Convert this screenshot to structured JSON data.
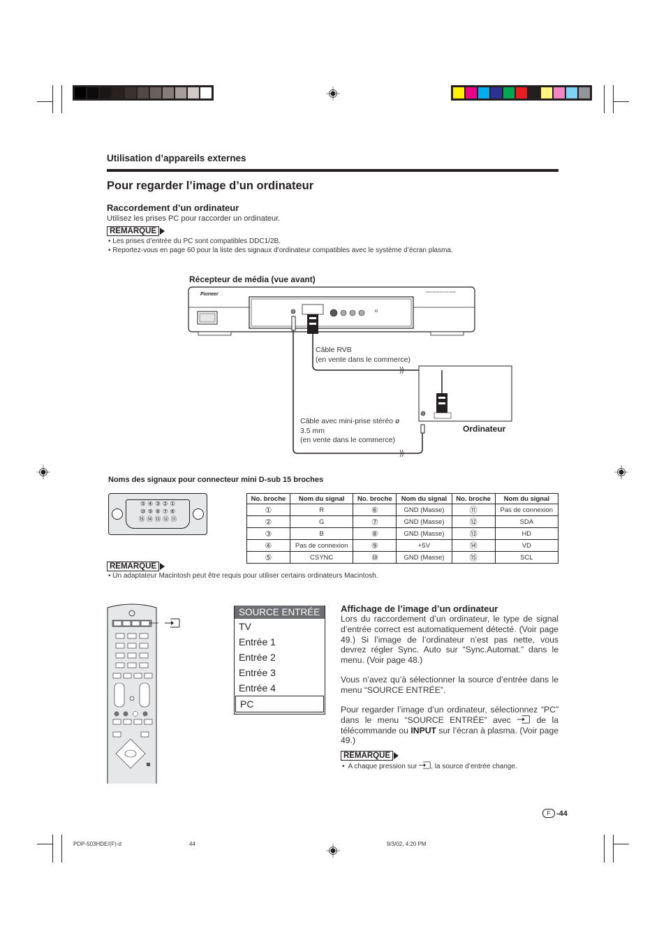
{
  "print_marks": {
    "grayscale_swatches": [
      "#000000",
      "#0d0b0b",
      "#1a1616",
      "#272220",
      "#3a3230",
      "#524845",
      "#6a605d",
      "#867c79",
      "#a69e9b",
      "#d1cac8",
      "#ffffff"
    ],
    "color_swatches": [
      "#fff200",
      "#ec008c",
      "#00aeef",
      "#2e3192",
      "#00a651",
      "#ed1c24",
      "#231f20",
      "#fff57e",
      "#f385c4",
      "#7dd4f5",
      "#939598"
    ]
  },
  "header": {
    "section": "Utilisation d’appareils externes",
    "title": "Pour regarder l’image d’un ordinateur"
  },
  "connection": {
    "heading": "Raccordement d’un ordinateur",
    "intro": "Utilisez les prises PC pour raccorder un ordinateur.",
    "remarque_label": "REMARQUE",
    "notes": [
      "Les prises d’entrée du PC sont compatibles DDC1/2B.",
      "Reportez-vous en page 60 pour la liste des signaux d’ordinateur compatibles avec le système d’écran plasma."
    ]
  },
  "diagram": {
    "receiver_label": "Récepteur de média (vue avant)",
    "brand": "Pioneer",
    "model_text": "MEDIA RECEIVER PDP-R503E",
    "rgb_cable_label_1": "Câble RVB",
    "rgb_cable_label_2": "(en vente dans le commerce)",
    "audio_cable_label_1": "Câble avec mini-prise stéréo ø",
    "audio_cable_label_2": "3.5 mm",
    "audio_cable_label_3": "(en vente dans le commerce)",
    "computer_label": "Ordinateur"
  },
  "pinout": {
    "title": "Noms des signaux pour connecteur mini D-sub 15 broches",
    "connector_rows": [
      [
        "⑤",
        "④",
        "③",
        "②",
        "①"
      ],
      [
        "⑩",
        "⑨",
        "⑧",
        "⑦",
        "⑥"
      ],
      [
        "⑮",
        "⑭",
        "⑬",
        "⑫",
        "⑪"
      ]
    ],
    "headers": [
      "No. broche",
      "Nom du signal",
      "No. broche",
      "Nom du signal",
      "No. broche",
      "Nom du signal"
    ],
    "rows": [
      [
        "①",
        "R",
        "⑥",
        "GND (Masse)",
        "⑪",
        "Pas de connexion"
      ],
      [
        "②",
        "G",
        "⑦",
        "GND (Masse)",
        "⑫",
        "SDA"
      ],
      [
        "③",
        "B",
        "⑧",
        "GND (Masse)",
        "⑬",
        "HD"
      ],
      [
        "④",
        "Pas de connexion",
        "⑨",
        "+5V",
        "⑭",
        "VD"
      ],
      [
        "⑤",
        "CSYNC",
        "⑩",
        "GND (Masse)",
        "⑮",
        "SCL"
      ]
    ],
    "remarque_label": "REMARQUE",
    "note": "Un adaptateur Macintosh peut être requis pour utiliser certains ordinateurs Macintosh."
  },
  "source_menu": {
    "header": "SOURCE ENTRÉE",
    "items": [
      "TV",
      "Entrée 1",
      "Entrée 2",
      "Entrée 3",
      "Entrée 4",
      "PC"
    ],
    "selected": "PC"
  },
  "display": {
    "heading": "Affichage de l’image d’un ordinateur",
    "para1": "Lors du raccordement d’un ordinateur, le type de signal d’entrée correct est automatiquement détecté. (Voir page 49.) Si l’image de l’ordinateur n’est pas nette, vous devrez régler Sync. Auto sur “Sync.Automat.” dans le menu. (Voir page 48.)",
    "para2": "Vous n’avez qu’à sélectionner la source d’entrée dans le menu “SOURCE ENTRÉE”.",
    "para3_a": "Pour regarder l’image d’un ordinateur, sélectionnez “PC” dans le menu “SOURCE ENTRÉE” avec",
    "para3_b": "de la télécommande ou",
    "para3_bold": "INPUT",
    "para3_c": "sur l’écran à plasma. (Voir page 49.)",
    "remarque_label": "REMARQUE",
    "note_a": "A chaque pression sur",
    "note_b": ", la source d’entrée change."
  },
  "page": {
    "lang_badge": "F",
    "number": "-44"
  },
  "footer": {
    "file": "PDP-503HDE/(F)-d",
    "page": "44",
    "date": "9/3/02, 4:20 PM"
  }
}
